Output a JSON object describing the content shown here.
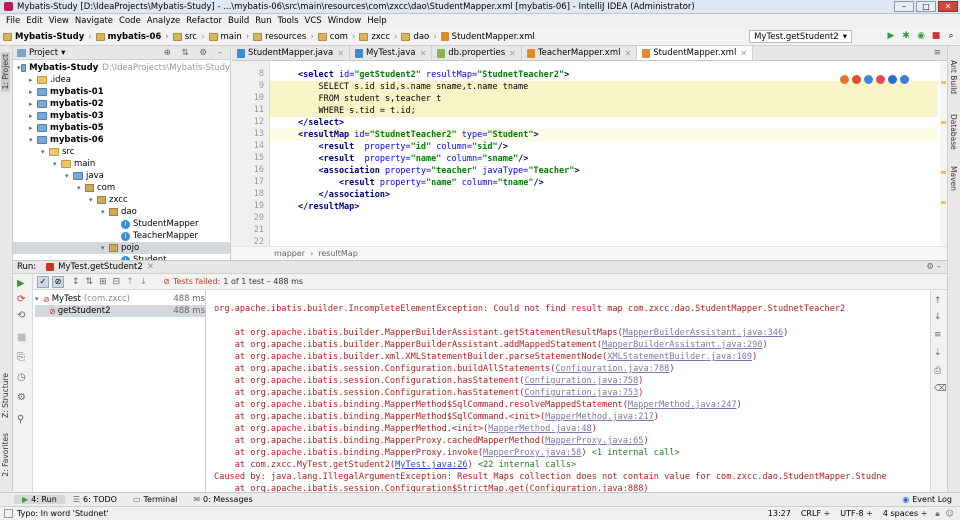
{
  "window": {
    "title": "Mybatis-Study [D:\\IdeaProjects\\Mybatis-Study] - ...\\mybatis-06\\src\\main\\resources\\com\\zxcc\\dao\\StudentMapper.xml [mybatis-06] - IntelliJ IDEA (Administrator)",
    "buttons": [
      "–",
      "□",
      "✕"
    ]
  },
  "menu": [
    "File",
    "Edit",
    "View",
    "Navigate",
    "Code",
    "Analyze",
    "Refactor",
    "Build",
    "Run",
    "Tools",
    "VCS",
    "Window",
    "Help"
  ],
  "nav": {
    "crumbs": [
      "Mybatis-Study",
      "mybatis-06",
      "src",
      "main",
      "resources",
      "com",
      "zxcc",
      "dao",
      "StudentMapper.xml"
    ],
    "run_config": "MyTest.getStudent2"
  },
  "left_strip": {
    "project": "1: Project",
    "structure": "Z: Structure",
    "favorites": "2: Favorites"
  },
  "right_strip": {
    "ant": "Ant Build",
    "database": "Database",
    "maven": "Maven"
  },
  "project": {
    "header": "Project",
    "tree": [
      {
        "label": "Mybatis-Study",
        "hint": "D:\\IdeaProjects\\Mybatis-Study",
        "indent": 0,
        "icon": "folder-blue",
        "arrow": "▾"
      },
      {
        "label": ".idea",
        "indent": 1,
        "icon": "folder",
        "arrow": "▸"
      },
      {
        "label": "mybatis-01",
        "indent": 1,
        "icon": "folder-blue",
        "arrow": "▸"
      },
      {
        "label": "mybatis-02",
        "indent": 1,
        "icon": "folder-blue",
        "arrow": "▸"
      },
      {
        "label": "mybatis-03",
        "indent": 1,
        "icon": "folder-blue",
        "arrow": "▸"
      },
      {
        "label": "mybatis-05",
        "indent": 1,
        "icon": "folder-blue",
        "arrow": "▸"
      },
      {
        "label": "mybatis-06",
        "indent": 1,
        "icon": "folder-blue",
        "arrow": "▾"
      },
      {
        "label": "src",
        "indent": 2,
        "icon": "folder",
        "arrow": "▾"
      },
      {
        "label": "main",
        "indent": 3,
        "icon": "folder",
        "arrow": "▾"
      },
      {
        "label": "java",
        "indent": 4,
        "icon": "folder-blue",
        "arrow": "▾"
      },
      {
        "label": "com",
        "indent": 5,
        "icon": "pkg",
        "arrow": "▾"
      },
      {
        "label": "zxcc",
        "indent": 6,
        "icon": "pkg",
        "arrow": "▾"
      },
      {
        "label": "dao",
        "indent": 7,
        "icon": "pkg",
        "arrow": "▾"
      },
      {
        "label": "StudentMapper",
        "indent": 8,
        "icon": "class",
        "arrow": ""
      },
      {
        "label": "TeacherMapper",
        "indent": 8,
        "icon": "class",
        "arrow": ""
      },
      {
        "label": "pojo",
        "indent": 7,
        "icon": "pkg",
        "arrow": "▾",
        "selected": true
      },
      {
        "label": "Student",
        "indent": 8,
        "icon": "class",
        "arrow": ""
      }
    ]
  },
  "tabs": [
    {
      "label": "StudentMapper.java",
      "type": "java"
    },
    {
      "label": "MyTest.java",
      "type": "java"
    },
    {
      "label": "db.properties",
      "type": "props"
    },
    {
      "label": "TeacherMapper.xml",
      "type": "xml"
    },
    {
      "label": "StudentMapper.xml",
      "type": "xml",
      "active": true
    }
  ],
  "editor": {
    "line_numbers": [
      "8",
      "9",
      "10",
      "11",
      "12",
      "13",
      "14",
      "15",
      "16",
      "17",
      "18",
      "19",
      "20",
      "21",
      "22"
    ],
    "lines": {
      "l8a": "<select ",
      "l8b": "id=",
      "l8c": "\"getStudent2\"",
      "l8d": " resultMap=",
      "l8e": "\"StudnetTeacher2\"",
      "l8f": ">",
      "l9": "    SELECT s.id sid,s.name sname,t.name tname",
      "l10": "    FROM student s,teacher t",
      "l11": "    WHERE s.tid = t.id;",
      "l12": "</select>",
      "l13a": "<resultMap ",
      "l13b": "id=",
      "l13c": "\"StudnetTeacher2\"",
      "l13d": " type=",
      "l13e": "\"Student\"",
      "l13f": ">",
      "l14a": "    <result  ",
      "l14b": "property=",
      "l14c": "\"id\"",
      "l14d": " column=",
      "l14e": "\"sid\"",
      "l14f": "/>",
      "l15a": "    <result  ",
      "l15b": "property=",
      "l15c": "\"name\"",
      "l15d": " column=",
      "l15e": "\"sname\"",
      "l15f": "/>",
      "l16a": "    <association ",
      "l16b": "property=",
      "l16c": "\"teacher\"",
      "l16d": " javaType=",
      "l16e": "\"Teacher\"",
      "l16f": ">",
      "l17a": "        <result ",
      "l17b": "property=",
      "l17c": "\"name\"",
      "l17d": " column=",
      "l17e": "\"tname\"",
      "l17f": "/>",
      "l18": "    </association>",
      "l19": "</resultMap>"
    },
    "breadcrumb": [
      "mapper",
      "resultMap"
    ]
  },
  "run": {
    "header_label": "Run:",
    "config": "MyTest.getStudent2",
    "status": "Tests failed:",
    "status_detail": "1 of 1 test – 488 ms",
    "tests": [
      {
        "name": "MyTest",
        "pkg": "(com.zxcc)",
        "time": "488 ms"
      },
      {
        "name": "getStudent2",
        "time": "488 ms"
      }
    ]
  },
  "console": {
    "exception": "org.apache.ibatis.builder.IncompleteElementException: Could not find result map com.zxcc.dao.StudentMapper.StudnetTeacher2",
    "frames": [
      {
        "text": "    at org.apache.ibatis.builder.MapperBuilderAssistant.getStatementResultMaps(",
        "link": "MapperBuilderAssistant.java:346",
        "end": ")"
      },
      {
        "text": "    at org.apache.ibatis.builder.MapperBuilderAssistant.addMappedStatement(",
        "link": "MapperBuilderAssistant.java:290",
        "end": ")"
      },
      {
        "text": "    at org.apache.ibatis.builder.xml.XMLStatementBuilder.parseStatementNode(",
        "link": "XMLStatementBuilder.java:109",
        "end": ")"
      },
      {
        "text": "    at org.apache.ibatis.session.Configuration.buildAllStatements(",
        "link": "Configuration.java:788",
        "end": ")"
      },
      {
        "text": "    at org.apache.ibatis.session.Configuration.hasStatement(",
        "link": "Configuration.java:758",
        "end": ")"
      },
      {
        "text": "    at org.apache.ibatis.session.Configuration.hasStatement(",
        "link": "Configuration.java:753",
        "end": ")"
      },
      {
        "text": "    at org.apache.ibatis.binding.MapperMethod$SqlCommand.resolveMappedStatement(",
        "link": "MapperMethod.java:247",
        "end": ")"
      },
      {
        "text": "    at org.apache.ibatis.binding.MapperMethod$SqlCommand.<init>(",
        "link": "MapperMethod.java:217",
        "end": ")"
      },
      {
        "text": "    at org.apache.ibatis.binding.MapperMethod.<init>(",
        "link": "MapperMethod.java:48",
        "end": ")"
      },
      {
        "text": "    at org.apache.ibatis.binding.MapperProxy.cachedMapperMethod(",
        "link": "MapperProxy.java:65",
        "end": ")"
      },
      {
        "text": "    at org.apache.ibatis.binding.MapperProxy.invoke(",
        "link": "MapperProxy.java:58",
        "end": ") ",
        "extra": "<1 internal call>"
      },
      {
        "text": "    at com.zxcc.MyTest.getStudent2(",
        "link": "MyTest.java:26",
        "end": ") ",
        "extra": "<22 internal calls>",
        "blue": true
      }
    ],
    "caused_by": "Caused by: java.lang.IllegalArgumentException: Result Maps collection does not contain value for com.zxcc.dao.StudentMapper.Studne",
    "last_frame": "    at org.apache.ibatis.session.Configuration$StrictMap.get(Configuration.java:888)"
  },
  "bottom_tabs": [
    {
      "label": "4: Run",
      "active": true
    },
    {
      "label": "6: TODO"
    },
    {
      "label": "Terminal"
    },
    {
      "label": "0: Messages"
    }
  ],
  "event_log": "Event Log",
  "status": {
    "message": "Typo: In word 'Studnet'",
    "position": "13:27",
    "line_sep": "CRLF ÷",
    "encoding": "UTF-8 ÷",
    "indent": "4 spaces ÷"
  },
  "colors": {
    "tag": "#000080",
    "attr": "#0000ff",
    "value": "#008000",
    "error": "#b41e1e"
  }
}
